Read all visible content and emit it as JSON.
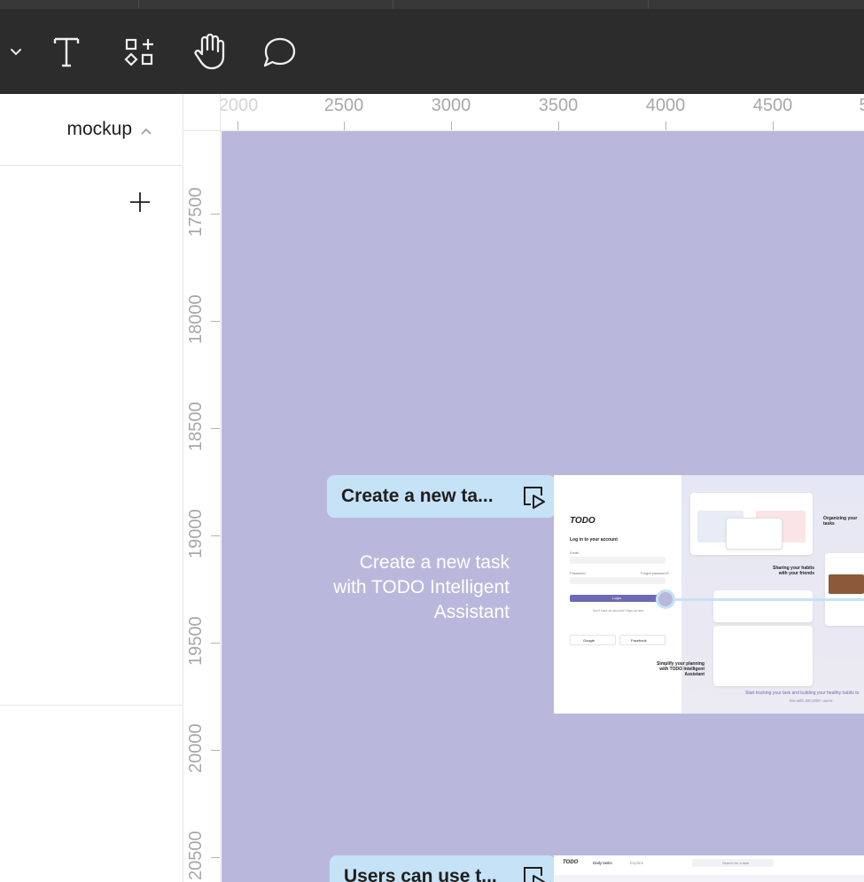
{
  "toolbar": {
    "tools": [
      {
        "name": "chevron-down-icon"
      },
      {
        "name": "text-tool-icon"
      },
      {
        "name": "shapes-tool-icon"
      },
      {
        "name": "hand-tool-icon"
      },
      {
        "name": "comment-tool-icon"
      }
    ]
  },
  "left_panel": {
    "page_name": "mockup",
    "add_label": "+"
  },
  "ruler": {
    "top": [
      "2000",
      "2500",
      "3000",
      "3500",
      "4000",
      "4500",
      "5"
    ],
    "left": [
      "17500",
      "18000",
      "18500",
      "19000",
      "19500",
      "20000",
      "20500"
    ]
  },
  "canvas": {
    "background": "#b9b8dc",
    "flows": [
      {
        "label": "Create a new ta...",
        "description_lines": [
          "Create a new task",
          "with TODO Intelligent",
          "Assistant"
        ]
      },
      {
        "label": "Users can use t..."
      }
    ]
  },
  "mockup1": {
    "logo": "TODO",
    "login_title": "Log in to your account",
    "email_label": "Email",
    "password_label": "Password",
    "forgot": "Forgot password?",
    "login_button": "Login",
    "signup": "Don't have an account? Sign up here",
    "google": "Google",
    "facebook": "Facebook",
    "organizing": "Organizing your tasks",
    "sharing": "Sharing your habits with your friends",
    "simplify": "Simplify your planning with TODO Intelligent Assistant",
    "footer": "Start tracking your task and building your healthy habits to",
    "footer2": "live with 300,000+ users"
  },
  "mockup2": {
    "logo": "TODO",
    "tab1": "Daily tasks",
    "tab2": "Explore",
    "search": "Search for a task"
  },
  "colors": {
    "toolbar_bg": "#2c2c2c",
    "canvas_bg": "#b9b8dc",
    "label_bg": "#c6e2f6",
    "accent": "#6d6ab3"
  }
}
